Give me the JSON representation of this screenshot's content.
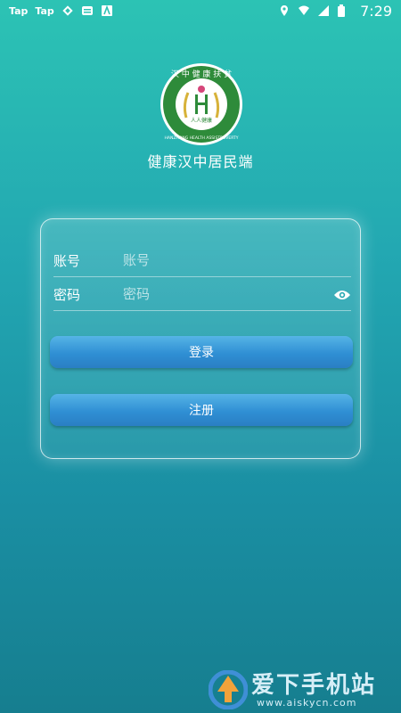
{
  "status_bar": {
    "left_items": [
      "Tap",
      "Tap"
    ],
    "time": "7:29"
  },
  "logo": {
    "ring_text": "汉中健康扶贫",
    "ring_text_en": "HANZHONG HEALTH ASSISTPOVERTY PROJECT",
    "center_text": "人人健康"
  },
  "app_title": "健康汉中居民端",
  "form": {
    "account_label": "账号",
    "account_placeholder": "账号",
    "password_label": "密码",
    "password_placeholder": "密码"
  },
  "buttons": {
    "login": "登录",
    "register": "注册"
  },
  "watermark": {
    "text": "爱下手机站",
    "url": "www.aiskycn.com"
  },
  "colors": {
    "background_top": "#2cc3b4",
    "background_bottom": "#167e8f",
    "button": "#2f8fd4",
    "logo_green": "#2e8b3a"
  }
}
